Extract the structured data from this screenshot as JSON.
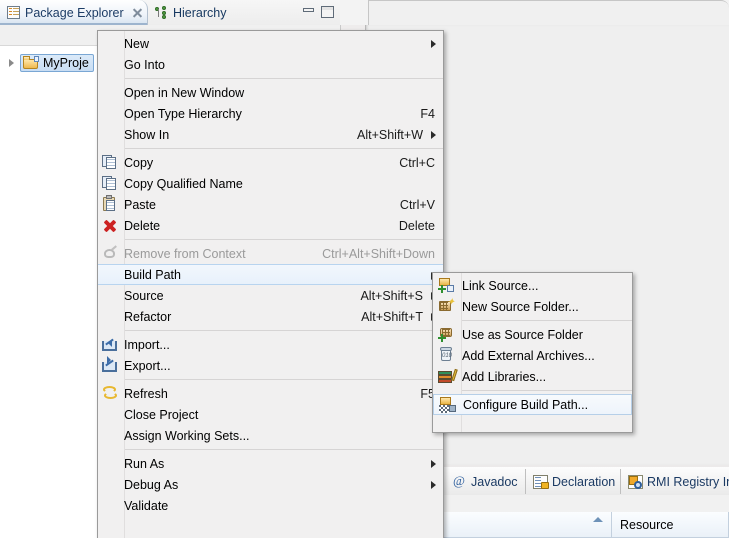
{
  "view_panel": {
    "tabs": [
      {
        "label": "Package Explorer",
        "icon": "package-explorer-icon",
        "active": true,
        "closable": true
      },
      {
        "label": "Hierarchy",
        "icon": "hierarchy-icon",
        "active": false,
        "closable": false
      }
    ],
    "window_controls": {
      "minimize": "Minimize",
      "maximize": "Maximize"
    },
    "tree": {
      "items": [
        {
          "label": "MyProje",
          "icon": "project-folder-icon",
          "selected": true,
          "expandable": true
        }
      ]
    }
  },
  "context_menu": {
    "items": [
      {
        "label": "New",
        "accel": "",
        "submenu": true,
        "icon": "",
        "state": "normal"
      },
      {
        "label": "Go Into",
        "accel": "",
        "submenu": false,
        "icon": "",
        "state": "normal"
      },
      {
        "separator": true
      },
      {
        "label": "Open in New Window",
        "accel": "",
        "submenu": false,
        "icon": "",
        "state": "normal"
      },
      {
        "label": "Open Type Hierarchy",
        "accel": "F4",
        "submenu": false,
        "icon": "",
        "state": "normal"
      },
      {
        "label": "Show In",
        "accel": "Alt+Shift+W",
        "submenu": true,
        "icon": "",
        "state": "normal"
      },
      {
        "separator": true
      },
      {
        "label": "Copy",
        "accel": "Ctrl+C",
        "submenu": false,
        "icon": "copy-icon",
        "state": "normal"
      },
      {
        "label": "Copy Qualified Name",
        "accel": "",
        "submenu": false,
        "icon": "copy-qualified-name-icon",
        "state": "normal"
      },
      {
        "label": "Paste",
        "accel": "Ctrl+V",
        "submenu": false,
        "icon": "paste-icon",
        "state": "normal"
      },
      {
        "label": "Delete",
        "accel": "Delete",
        "submenu": false,
        "icon": "delete-icon",
        "state": "normal"
      },
      {
        "separator": true
      },
      {
        "label": "Remove from Context",
        "accel": "Ctrl+Alt+Shift+Down",
        "submenu": false,
        "icon": "remove-from-context-icon",
        "state": "disabled"
      },
      {
        "label": "Build Path",
        "accel": "",
        "submenu": true,
        "icon": "",
        "state": "highlighted"
      },
      {
        "label": "Source",
        "accel": "Alt+Shift+S",
        "submenu": true,
        "icon": "",
        "state": "normal"
      },
      {
        "label": "Refactor",
        "accel": "Alt+Shift+T",
        "submenu": true,
        "icon": "",
        "state": "normal"
      },
      {
        "separator": true
      },
      {
        "label": "Import...",
        "accel": "",
        "submenu": false,
        "icon": "import-icon",
        "state": "normal"
      },
      {
        "label": "Export...",
        "accel": "",
        "submenu": false,
        "icon": "export-icon",
        "state": "normal"
      },
      {
        "separator": true
      },
      {
        "label": "Refresh",
        "accel": "F5",
        "submenu": false,
        "icon": "refresh-icon",
        "state": "normal"
      },
      {
        "label": "Close Project",
        "accel": "",
        "submenu": false,
        "icon": "",
        "state": "normal"
      },
      {
        "label": "Assign Working Sets...",
        "accel": "",
        "submenu": false,
        "icon": "",
        "state": "normal"
      },
      {
        "separator": true
      },
      {
        "label": "Run As",
        "accel": "",
        "submenu": true,
        "icon": "",
        "state": "normal"
      },
      {
        "label": "Debug As",
        "accel": "",
        "submenu": true,
        "icon": "",
        "state": "normal"
      },
      {
        "label": "Validate",
        "accel": "",
        "submenu": false,
        "icon": "",
        "state": "normal"
      }
    ]
  },
  "build_path_submenu": {
    "items": [
      {
        "label": "Link Source...",
        "icon": "link-source-icon",
        "state": "normal"
      },
      {
        "label": "New Source Folder...",
        "icon": "new-source-folder-icon",
        "state": "normal"
      },
      {
        "separator": true
      },
      {
        "label": "Use as Source Folder",
        "icon": "use-as-source-folder-icon",
        "state": "normal"
      },
      {
        "label": "Add External Archives...",
        "icon": "add-external-archives-icon",
        "state": "normal"
      },
      {
        "label": "Add Libraries...",
        "icon": "add-libraries-icon",
        "state": "normal"
      },
      {
        "separator": true
      },
      {
        "label": "Configure Build Path...",
        "icon": "configure-build-path-icon",
        "state": "outlined"
      }
    ]
  },
  "bottom_panel": {
    "tabs": [
      {
        "label": "Javadoc",
        "icon": "javadoc-icon"
      },
      {
        "label": "Declaration",
        "icon": "declaration-icon"
      },
      {
        "label": "RMI Registry Inspe",
        "icon": "rmi-registry-icon"
      }
    ],
    "table": {
      "columns": [
        {
          "label": "",
          "sorted": true
        },
        {
          "label": "Resource",
          "sorted": false
        }
      ]
    }
  },
  "colors": {
    "menu_bg": "#f1f0f0",
    "menu_border": "#9a9a9a",
    "highlight_bg": "#eaf2fb",
    "highlight_border": "#b8d4ef",
    "tab_active_text": "#1d3d66",
    "disabled_text": "#9a9a9a",
    "tree_selection": "#c8ddf3"
  }
}
